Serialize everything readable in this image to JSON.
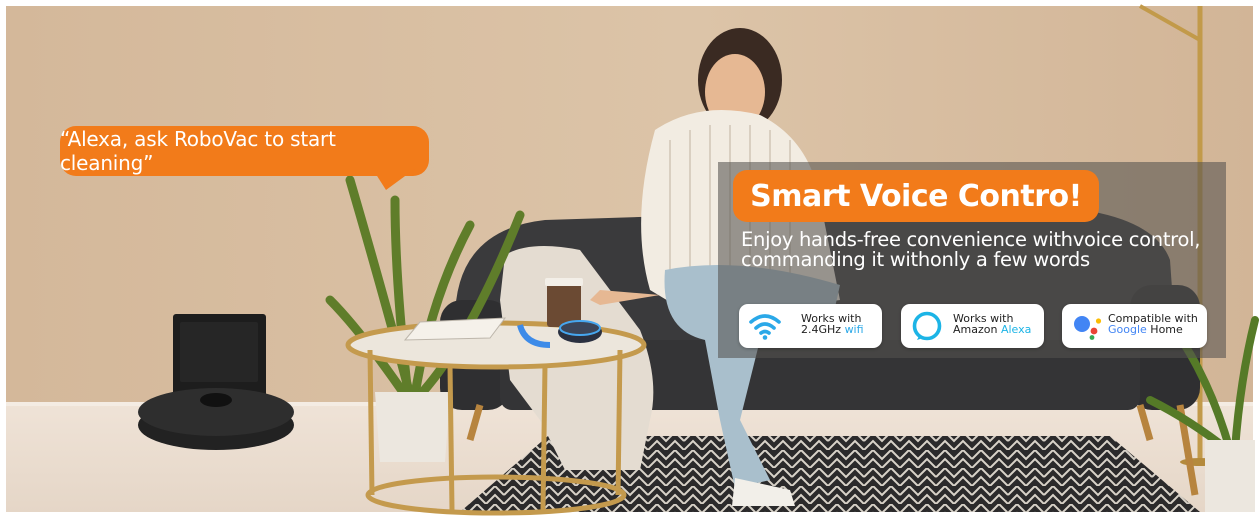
{
  "speech_bubble": {
    "text": "“Alexa, ask RoboVac to start cleaning”"
  },
  "panel": {
    "title": "Smart Voice Contro!",
    "subtitle_line1": "Enjoy hands-free convenience withvoice control,",
    "subtitle_line2": "commanding it withonly a few words"
  },
  "badges": [
    {
      "icon": "wifi-icon",
      "line1": "Works with",
      "line2_prefix": "2.4GHz ",
      "line2_accent": "wifi"
    },
    {
      "icon": "alexa-icon",
      "line1": "Works with",
      "line2_prefix": "Amazon ",
      "line2_accent": "Alexa"
    },
    {
      "icon": "google-assistant-icon",
      "line1": "Compatible with",
      "line2_accent": "Google",
      "line2_suffix": " Home"
    }
  ],
  "colors": {
    "accent_orange": "#f27b1a",
    "wall_beige": "#d9c0a2",
    "wifi_blue": "#2aa8e8",
    "alexa_cyan": "#1cb4e6"
  }
}
